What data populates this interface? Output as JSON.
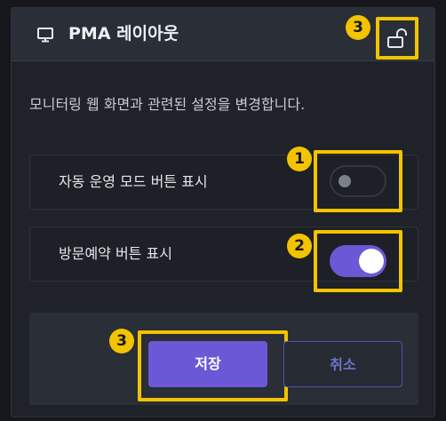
{
  "header": {
    "title": "PMA 레이아웃",
    "title_icon": "monitor-icon",
    "lock_icon": "unlock-icon",
    "lock_badge": "3"
  },
  "description": "모니터링 웹 화면과 관련된 설정을 변경합니다.",
  "settings": [
    {
      "label": "자동 운영 모드 버튼 표시",
      "enabled": false,
      "badge": "1"
    },
    {
      "label": "방문예약 버튼 표시",
      "enabled": true,
      "badge": "2"
    }
  ],
  "footer": {
    "save_label": "저장",
    "cancel_label": "취소",
    "save_badge": "3"
  },
  "colors": {
    "accent": "#6a58d6",
    "highlight": "#f3c300",
    "background": "#1f2228",
    "header": "#2a2e36"
  }
}
